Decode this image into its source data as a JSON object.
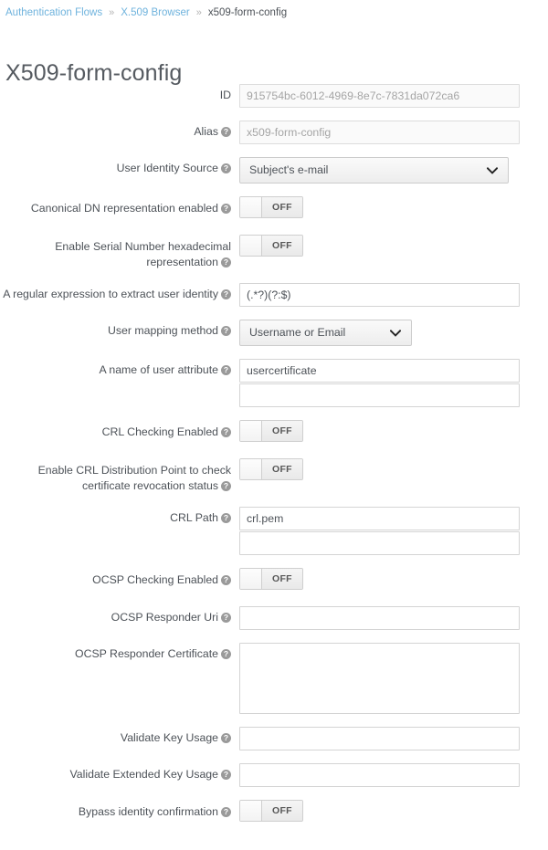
{
  "breadcrumb": {
    "items": [
      {
        "label": "Authentication Flows",
        "link": true
      },
      {
        "label": "X.509 Browser",
        "link": true
      },
      {
        "label": "x509-form-config",
        "link": false
      }
    ],
    "separator": "»"
  },
  "page": {
    "title": "X509-form-config"
  },
  "help_icon": "?",
  "colors": {
    "breadcrumb_link": "#6fb3dd",
    "text": "#4d5258",
    "title": "#555a60",
    "input_border": "#d4d4d4",
    "disabled_bg": "#fafafa"
  },
  "form": {
    "fields": [
      {
        "id": "id",
        "label": "ID",
        "has_help": false,
        "type": "text",
        "value": "915754bc-6012-4969-8e7c-7831da072ca6",
        "disabled": true
      },
      {
        "id": "alias",
        "label": "Alias",
        "has_help": true,
        "type": "text",
        "value": "x509-form-config",
        "disabled": true
      },
      {
        "id": "user-identity-source",
        "label": "User Identity Source",
        "has_help": true,
        "type": "select",
        "width": "wide",
        "value": "Subject's e-mail"
      },
      {
        "id": "canonical-dn-representation-enabled",
        "label": "Canonical DN representation enabled",
        "has_help": true,
        "type": "toggle",
        "value": "OFF"
      },
      {
        "id": "enable-serial-number-hexadecimal-representation",
        "label": "Enable Serial Number hexadecimal representation",
        "has_help": true,
        "type": "toggle",
        "value": "OFF"
      },
      {
        "id": "regular-expression-to-extract-user-identity",
        "label": "A regular expression to extract user identity",
        "has_help": true,
        "type": "text",
        "value": "(.*?)(?:$)",
        "disabled": false
      },
      {
        "id": "user-mapping-method",
        "label": "User mapping method",
        "has_help": true,
        "type": "select",
        "width": "narrow",
        "value": "Username or Email"
      },
      {
        "id": "name-of-user-attribute",
        "label": "A name of user attribute",
        "has_help": true,
        "type": "text-stacked",
        "value": "usercertificate",
        "value2": "",
        "disabled": false
      },
      {
        "id": "crl-checking-enabled",
        "label": "CRL Checking Enabled",
        "has_help": true,
        "type": "toggle",
        "value": "OFF"
      },
      {
        "id": "enable-crl-distribution-point",
        "label": "Enable CRL Distribution Point to check certificate revocation status",
        "has_help": true,
        "type": "toggle",
        "value": "OFF"
      },
      {
        "id": "crl-path",
        "label": "CRL Path",
        "has_help": true,
        "type": "text-stacked",
        "value": "crl.pem",
        "value2": "",
        "disabled": false
      },
      {
        "id": "ocsp-checking-enabled",
        "label": "OCSP Checking Enabled",
        "has_help": true,
        "type": "toggle",
        "value": "OFF"
      },
      {
        "id": "ocsp-responder-uri",
        "label": "OCSP Responder Uri",
        "has_help": true,
        "type": "text",
        "value": "",
        "disabled": false
      },
      {
        "id": "ocsp-responder-certificate",
        "label": "OCSP Responder Certificate",
        "has_help": true,
        "type": "textarea",
        "value": ""
      },
      {
        "id": "validate-key-usage",
        "label": "Validate Key Usage",
        "has_help": true,
        "type": "text",
        "value": "",
        "disabled": false
      },
      {
        "id": "validate-extended-key-usage",
        "label": "Validate Extended Key Usage",
        "has_help": true,
        "type": "text",
        "value": "",
        "disabled": false
      },
      {
        "id": "bypass-identity-confirmation",
        "label": "Bypass identity confirmation",
        "has_help": true,
        "type": "toggle",
        "value": "OFF"
      }
    ]
  }
}
